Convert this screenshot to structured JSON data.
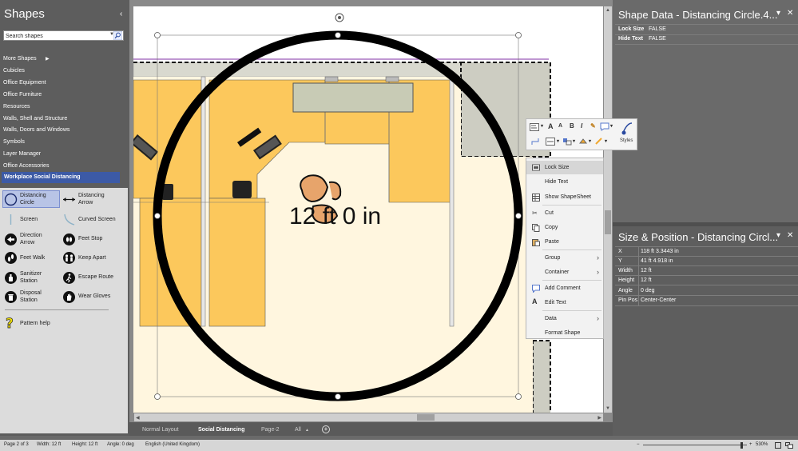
{
  "shapes_pane": {
    "title": "Shapes",
    "collapse_glyph": "‹",
    "search_placeholder": "Search shapes",
    "more_shapes": "More Shapes",
    "stencils": [
      "Cubicles",
      "Office Equipment",
      "Office Furniture",
      "Resources",
      "Walls, Shell and Structure",
      "Walls, Doors and Windows",
      "Symbols",
      "Layer Manager",
      "Office Accessories"
    ],
    "active_stencil": "Workplace Social Distancing",
    "masters": [
      {
        "label1": "Distancing",
        "label2": "Circle",
        "icon": "distancing-circle-icon"
      },
      {
        "label1": "Distancing",
        "label2": "Arrow",
        "icon": "distancing-arrow-icon"
      },
      {
        "label1": "Screen",
        "label2": "",
        "icon": "screen-icon"
      },
      {
        "label1": "Curved Screen",
        "label2": "",
        "icon": "curved-screen-icon"
      },
      {
        "label1": "Direction",
        "label2": "Arrow",
        "icon": "direction-arrow-icon"
      },
      {
        "label1": "Feet Stop",
        "label2": "",
        "icon": "feet-stop-icon"
      },
      {
        "label1": "Feet Walk",
        "label2": "",
        "icon": "feet-walk-icon"
      },
      {
        "label1": "Keep Apart",
        "label2": "",
        "icon": "keep-apart-icon"
      },
      {
        "label1": "Sanitizer",
        "label2": "Station",
        "icon": "sanitizer-station-icon"
      },
      {
        "label1": "Escape Route",
        "label2": "",
        "icon": "escape-route-icon"
      },
      {
        "label1": "Disposal",
        "label2": "Station",
        "icon": "disposal-station-icon"
      },
      {
        "label1": "Wear Gloves",
        "label2": "",
        "icon": "wear-gloves-icon"
      }
    ],
    "pattern_help": "Pattern help"
  },
  "canvas": {
    "circle_text": "12 ft 0 in"
  },
  "mini_toolbar": {
    "font_grow": "A",
    "font_shrink": "A",
    "bold": "B",
    "italic": "I",
    "styles": "Styles"
  },
  "context_menu": {
    "items": [
      {
        "label": "Lock Size",
        "icon": "lock-size-icon"
      },
      {
        "label": "Hide Text",
        "icon": ""
      },
      {
        "label": "Show ShapeSheet",
        "icon": "shapesheet-icon"
      },
      {
        "label": "Cut",
        "icon": "cut-icon"
      },
      {
        "label": "Copy",
        "icon": "copy-icon"
      },
      {
        "label": "Paste",
        "icon": "paste-icon"
      },
      {
        "label": "Group",
        "icon": ""
      },
      {
        "label": "Container",
        "icon": ""
      },
      {
        "label": "Add Comment",
        "icon": "comment-icon"
      },
      {
        "label": "Edit Text",
        "icon": "edit-text-icon"
      },
      {
        "label": "Data",
        "icon": ""
      },
      {
        "label": "Format Shape",
        "icon": ""
      }
    ]
  },
  "shape_data": {
    "title": "Shape Data - Distancing Circle.4...",
    "rows": [
      {
        "label": "Lock Size",
        "value": "FALSE"
      },
      {
        "label": "Hide Text",
        "value": "FALSE"
      }
    ]
  },
  "size_position": {
    "title": "Size & Position - Distancing Circl...",
    "rows": [
      {
        "label": "X",
        "value": "118 ft 3.3443 in"
      },
      {
        "label": "Y",
        "value": "41 ft 4.918 in"
      },
      {
        "label": "Width",
        "value": "12 ft"
      },
      {
        "label": "Height",
        "value": "12 ft"
      },
      {
        "label": "Angle",
        "value": "0 deg"
      },
      {
        "label": "Pin Pos",
        "value": "Center-Center"
      }
    ]
  },
  "tabs": {
    "items": [
      "Normal Layout",
      "Social Distancing",
      "Page-2",
      "All"
    ],
    "active": "Social Distancing",
    "add": "+"
  },
  "status_bar": {
    "page": "Page 2 of 3",
    "width": "Width: 12 ft",
    "height": "Height: 12 ft",
    "angle": "Angle: 0 deg",
    "language": "English (United Kingdom)",
    "zoom": "530%"
  },
  "colors": {
    "accent": "#3c5aa6",
    "floor_yellow": "#fcc85c",
    "floor_cream": "#fff6df",
    "wall_gray": "#cfcfc0"
  }
}
